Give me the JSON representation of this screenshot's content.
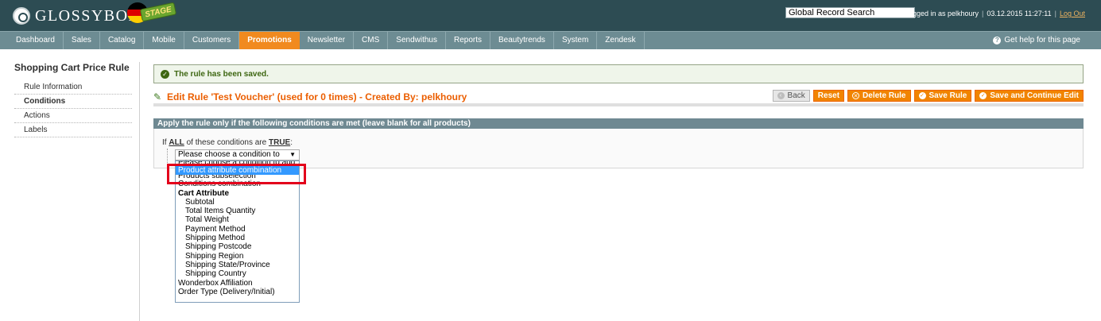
{
  "header": {
    "logo_text": "GLOSSYBOX",
    "stage_badge": "STAGE",
    "search_value": "Global Record Search",
    "user_text": "Logged in as pelkhoury",
    "datetime": "03.12.2015 11:27:11",
    "logout_label": "Log Out"
  },
  "nav": {
    "items": [
      "Dashboard",
      "Sales",
      "Catalog",
      "Mobile",
      "Customers",
      "Promotions",
      "Newsletter",
      "CMS",
      "Sendwithus",
      "Reports",
      "Beautytrends",
      "System",
      "Zendesk"
    ],
    "active_index": 5,
    "help_label": "Get help for this page"
  },
  "sidebar": {
    "title": "Shopping Cart Price Rule",
    "tabs": [
      "Rule Information",
      "Conditions",
      "Actions",
      "Labels"
    ],
    "active_index": 1
  },
  "message": {
    "text": "The rule has been saved."
  },
  "page": {
    "title": "Edit Rule 'Test Voucher' (used for 0 times) - Created By: pelkhoury"
  },
  "buttons": {
    "back": "Back",
    "reset": "Reset",
    "delete": "Delete Rule",
    "save": "Save Rule",
    "save_continue": "Save and Continue Edit"
  },
  "conditions": {
    "header": "Apply the rule only if the following conditions are met (leave blank for all products)",
    "line_prefix": "If",
    "aggregator": "ALL",
    "line_middle": "of these conditions are",
    "value": "TRUE",
    "line_suffix": ":",
    "select_value": "Please choose a condition to add..."
  },
  "dropdown": {
    "options": [
      {
        "label": "Please choose a condition to add...",
        "kind": "clipped"
      },
      {
        "label": "Product attribute combination",
        "kind": "selected"
      },
      {
        "label": "Products subselection",
        "kind": "clipped"
      },
      {
        "label": "Conditions combination",
        "kind": "normal"
      },
      {
        "label": "Cart Attribute",
        "kind": "group"
      },
      {
        "label": "Subtotal",
        "kind": "child"
      },
      {
        "label": "Total Items Quantity",
        "kind": "child"
      },
      {
        "label": "Total Weight",
        "kind": "child"
      },
      {
        "label": "Payment Method",
        "kind": "child"
      },
      {
        "label": "Shipping Method",
        "kind": "child"
      },
      {
        "label": "Shipping Postcode",
        "kind": "child"
      },
      {
        "label": "Shipping Region",
        "kind": "child"
      },
      {
        "label": "Shipping State/Province",
        "kind": "child"
      },
      {
        "label": "Shipping Country",
        "kind": "child"
      },
      {
        "label": "Wonderbox Affiliation",
        "kind": "normal"
      },
      {
        "label": "Order Type (Delivery/Initial)",
        "kind": "normal"
      }
    ]
  },
  "colors": {
    "header_bg": "#2d4c53",
    "nav_bg": "#6d8c93",
    "accent": "#f18a1f",
    "title_orange": "#eb5e00",
    "success_green": "#3d6611",
    "highlight_red": "#e3001b",
    "selected_blue": "#3399ff"
  }
}
